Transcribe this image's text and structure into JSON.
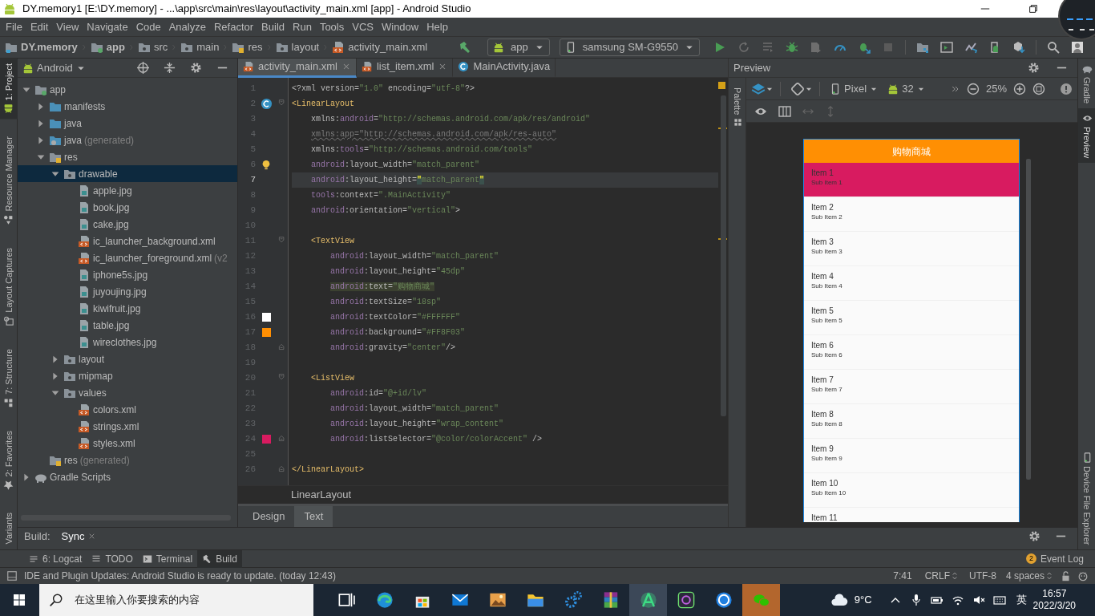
{
  "window": {
    "title": "DY.memory1 [E:\\DY.memory] - ...\\app\\src\\main\\res\\layout\\activity_main.xml [app] - Android Studio"
  },
  "menu": [
    "File",
    "Edit",
    "View",
    "Navigate",
    "Code",
    "Analyze",
    "Refactor",
    "Build",
    "Run",
    "Tools",
    "VCS",
    "Window",
    "Help"
  ],
  "breadcrumb": [
    {
      "label": "DY.memory",
      "kind": "project"
    },
    {
      "label": "app",
      "kind": "module"
    },
    {
      "label": "src",
      "kind": "folder"
    },
    {
      "label": "main",
      "kind": "folder"
    },
    {
      "label": "res",
      "kind": "res-folder"
    },
    {
      "label": "layout",
      "kind": "package"
    },
    {
      "label": "activity_main.xml",
      "kind": "xml"
    }
  ],
  "toolbar": {
    "run_config": "app",
    "device": "samsung SM-G9550"
  },
  "left_strip": [
    {
      "label": "1: Project",
      "kind": "android",
      "selected": true
    },
    {
      "label": "Resource Manager",
      "kind": "shapes",
      "selected": false
    },
    {
      "label": "Layout Captures",
      "kind": "capture",
      "selected": false
    },
    {
      "label": "7: Structure",
      "kind": "structure",
      "selected": false
    },
    {
      "label": "2: Favorites",
      "kind": "star",
      "selected": false
    },
    {
      "label": "Variants",
      "kind": "none",
      "selected": false
    }
  ],
  "project": {
    "view": "Android",
    "tree": [
      {
        "label": "app",
        "kind": "module",
        "expanded": true,
        "selected": false,
        "children": [
          {
            "label": "manifests",
            "kind": "folder",
            "expanded": false,
            "selected": false
          },
          {
            "label": "java",
            "kind": "folder",
            "expanded": false,
            "selected": false
          },
          {
            "label": "java",
            "suffix": "(generated)",
            "kind": "generated-folder",
            "expanded": false,
            "selected": false
          },
          {
            "label": "res",
            "kind": "res-folder",
            "expanded": true,
            "selected": false,
            "children": [
              {
                "label": "drawable",
                "kind": "package",
                "expanded": true,
                "selected": true,
                "children": [
                  {
                    "label": "apple.jpg",
                    "kind": "image",
                    "selected": false
                  },
                  {
                    "label": "book.jpg",
                    "kind": "image",
                    "selected": false
                  },
                  {
                    "label": "cake.jpg",
                    "kind": "image",
                    "selected": false
                  },
                  {
                    "label": "ic_launcher_background.xml",
                    "kind": "xml",
                    "selected": false
                  },
                  {
                    "label": "ic_launcher_foreground.xml",
                    "suffix": "(v2",
                    "kind": "xml",
                    "selected": false
                  },
                  {
                    "label": "iphone5s.jpg",
                    "kind": "image",
                    "selected": false
                  },
                  {
                    "label": "juyoujing.jpg",
                    "kind": "image",
                    "selected": false
                  },
                  {
                    "label": "kiwifruit.jpg",
                    "kind": "image",
                    "selected": false
                  },
                  {
                    "label": "table.jpg",
                    "kind": "image",
                    "selected": false
                  },
                  {
                    "label": "wireclothes.jpg",
                    "kind": "image",
                    "selected": false
                  }
                ]
              },
              {
                "label": "layout",
                "kind": "package",
                "expanded": false,
                "selected": false
              },
              {
                "label": "mipmap",
                "kind": "package",
                "expanded": false,
                "selected": false
              },
              {
                "label": "values",
                "kind": "package",
                "expanded": true,
                "selected": false,
                "children": [
                  {
                    "label": "colors.xml",
                    "kind": "xml",
                    "selected": false
                  },
                  {
                    "label": "strings.xml",
                    "kind": "xml",
                    "selected": false
                  },
                  {
                    "label": "styles.xml",
                    "kind": "xml",
                    "selected": false
                  }
                ]
              }
            ]
          },
          {
            "label": "res",
            "suffix": "(generated)",
            "kind": "res-folder",
            "selected": false
          }
        ]
      },
      {
        "label": "Gradle Scripts",
        "kind": "gradle",
        "expanded": false,
        "selected": false
      }
    ]
  },
  "editor": {
    "tabs": [
      {
        "label": "activity_main.xml",
        "kind": "xml",
        "closable": true,
        "selected": true
      },
      {
        "label": "list_item.xml",
        "kind": "xml",
        "closable": true,
        "selected": false
      },
      {
        "label": "MainActivity.java",
        "kind": "class",
        "closable": false,
        "selected": false
      }
    ],
    "lines": [
      {
        "number": "1",
        "current": false,
        "tokens": [
          {
            "text": "<?xml version=",
            "kind": "attr"
          },
          {
            "text": "\"1.0\"",
            "kind": "value"
          },
          {
            "text": " encoding=",
            "kind": "attr"
          },
          {
            "text": "\"utf-8\"",
            "kind": "value"
          },
          {
            "text": "?>",
            "kind": "attr"
          }
        ]
      },
      {
        "number": "2",
        "current": false,
        "gutter": {
          "kind": "class"
        },
        "fold": {
          "kind": "start"
        },
        "tokens": [
          {
            "text": "<LinearLayout",
            "kind": "tag"
          }
        ]
      },
      {
        "number": "3",
        "current": false,
        "tokens": [
          {
            "text": "    xmlns:",
            "kind": "attr"
          },
          {
            "text": "android",
            "kind": "ns"
          },
          {
            "text": "=",
            "kind": "attr"
          },
          {
            "text": "\"http://schemas.android.com/apk/res/android\"",
            "kind": "value"
          }
        ]
      },
      {
        "number": "4",
        "current": false,
        "tokens": [
          {
            "text": "    xmlns:app=\"http://schemas.android.com/apk/res-auto\"",
            "kind": "warning"
          }
        ]
      },
      {
        "number": "5",
        "current": false,
        "tokens": [
          {
            "text": "    xmlns:",
            "kind": "attr"
          },
          {
            "text": "tools",
            "kind": "ns"
          },
          {
            "text": "=",
            "kind": "attr"
          },
          {
            "text": "\"http://schemas.android.com/tools\"",
            "kind": "value"
          }
        ]
      },
      {
        "number": "6",
        "current": false,
        "gutter": {
          "kind": "bulb"
        },
        "tokens": [
          {
            "text": "    android",
            "kind": "ns"
          },
          {
            "text": ":layout_width=",
            "kind": "attr"
          },
          {
            "text": "\"match_parent\"",
            "kind": "value"
          }
        ]
      },
      {
        "number": "7",
        "current": true,
        "tokens": [
          {
            "text": "    android",
            "kind": "ns"
          },
          {
            "text": ":layout_height=",
            "kind": "attr"
          },
          {
            "text": "\"",
            "kind": "brace"
          },
          {
            "text": "match_parent",
            "kind": "value"
          },
          {
            "text": "\"",
            "kind": "brace"
          }
        ]
      },
      {
        "number": "8",
        "current": false,
        "tokens": [
          {
            "text": "    tools",
            "kind": "ns"
          },
          {
            "text": ":context=",
            "kind": "attr"
          },
          {
            "text": "\".MainActivity\"",
            "kind": "value"
          }
        ]
      },
      {
        "number": "9",
        "current": false,
        "tokens": [
          {
            "text": "    android",
            "kind": "ns"
          },
          {
            "text": ":orientation=",
            "kind": "attr"
          },
          {
            "text": "\"vertical\"",
            "kind": "value"
          },
          {
            "text": ">",
            "kind": "attr"
          }
        ]
      },
      {
        "number": "10",
        "current": false
      },
      {
        "number": "11",
        "current": false,
        "fold": {
          "kind": "start"
        },
        "tokens": [
          {
            "text": "    <TextView",
            "kind": "tag"
          }
        ]
      },
      {
        "number": "12",
        "current": false,
        "tokens": [
          {
            "text": "        android",
            "kind": "ns"
          },
          {
            "text": ":layout_width=",
            "kind": "attr"
          },
          {
            "text": "\"match_parent\"",
            "kind": "value"
          }
        ]
      },
      {
        "number": "13",
        "current": false,
        "tokens": [
          {
            "text": "        android",
            "kind": "ns"
          },
          {
            "text": ":layout_height=",
            "kind": "attr"
          },
          {
            "text": "\"45dp\"",
            "kind": "value"
          }
        ]
      },
      {
        "number": "14",
        "current": false,
        "tokens": [
          {
            "text": "        android",
            "kind": "match-ns"
          },
          {
            "text": ":text=",
            "kind": "match-attr"
          },
          {
            "text": "\"购物商城\"",
            "kind": "match-value"
          }
        ]
      },
      {
        "number": "15",
        "current": false,
        "tokens": [
          {
            "text": "        android",
            "kind": "ns"
          },
          {
            "text": ":textSize=",
            "kind": "attr"
          },
          {
            "text": "\"18sp\"",
            "kind": "value"
          }
        ]
      },
      {
        "number": "16",
        "current": false,
        "gutter": {
          "kind": "color",
          "color": "#ffffff"
        },
        "tokens": [
          {
            "text": "        android",
            "kind": "ns"
          },
          {
            "text": ":textColor=",
            "kind": "attr"
          },
          {
            "text": "\"#FFFFFF\"",
            "kind": "value"
          }
        ]
      },
      {
        "number": "17",
        "current": false,
        "gutter": {
          "kind": "color",
          "color": "#ff8f03"
        },
        "tokens": [
          {
            "text": "        android",
            "kind": "ns"
          },
          {
            "text": ":background=",
            "kind": "attr"
          },
          {
            "text": "\"#FF8F03\"",
            "kind": "value"
          }
        ]
      },
      {
        "number": "18",
        "current": false,
        "fold": {
          "kind": "end"
        },
        "tokens": [
          {
            "text": "        android",
            "kind": "ns"
          },
          {
            "text": ":gravity=",
            "kind": "attr"
          },
          {
            "text": "\"center\"",
            "kind": "value"
          },
          {
            "text": "/>",
            "kind": "attr"
          }
        ]
      },
      {
        "number": "19",
        "current": false
      },
      {
        "number": "20",
        "current": false,
        "fold": {
          "kind": "start"
        },
        "tokens": [
          {
            "text": "    <ListView",
            "kind": "tag"
          }
        ]
      },
      {
        "number": "21",
        "current": false,
        "tokens": [
          {
            "text": "        android",
            "kind": "ns"
          },
          {
            "text": ":id=",
            "kind": "attr"
          },
          {
            "text": "\"@+id/lv\"",
            "kind": "value"
          }
        ]
      },
      {
        "number": "22",
        "current": false,
        "tokens": [
          {
            "text": "        android",
            "kind": "ns"
          },
          {
            "text": ":layout_width=",
            "kind": "attr"
          },
          {
            "text": "\"match_parent\"",
            "kind": "value"
          }
        ]
      },
      {
        "number": "23",
        "current": false,
        "tokens": [
          {
            "text": "        android",
            "kind": "ns"
          },
          {
            "text": ":layout_height=",
            "kind": "attr"
          },
          {
            "text": "\"wrap_content\"",
            "kind": "value"
          }
        ]
      },
      {
        "number": "24",
        "current": false,
        "gutter": {
          "kind": "color",
          "color": "#d81b60"
        },
        "fold": {
          "kind": "end"
        },
        "tokens": [
          {
            "text": "        android",
            "kind": "ns"
          },
          {
            "text": ":listSelector=",
            "kind": "attr"
          },
          {
            "text": "\"@color/colorAccent\"",
            "kind": "value"
          },
          {
            "text": " />",
            "kind": "attr"
          }
        ]
      },
      {
        "number": "25",
        "current": false
      },
      {
        "number": "26",
        "current": false,
        "fold": {
          "kind": "end"
        },
        "tokens": [
          {
            "text": "</LinearLayout>",
            "kind": "tag"
          }
        ]
      }
    ],
    "breadcrumb": "LinearLayout",
    "mode_tabs": [
      {
        "label": "Design",
        "selected": false
      },
      {
        "label": "Text",
        "selected": true
      }
    ]
  },
  "preview": {
    "title": "Preview",
    "palette": "Palette",
    "device": "Pixel",
    "api": "32",
    "zoom": "25%",
    "phone": {
      "title": "购物商城",
      "items": [
        {
          "title": "Item 1",
          "subtitle": "Sub Item 1",
          "selected": true
        },
        {
          "title": "Item 2",
          "subtitle": "Sub Item 2",
          "selected": false
        },
        {
          "title": "Item 3",
          "subtitle": "Sub Item 3",
          "selected": false
        },
        {
          "title": "Item 4",
          "subtitle": "Sub Item 4",
          "selected": false
        },
        {
          "title": "Item 5",
          "subtitle": "Sub Item 5",
          "selected": false
        },
        {
          "title": "Item 6",
          "subtitle": "Sub Item 6",
          "selected": false
        },
        {
          "title": "Item 7",
          "subtitle": "Sub Item 7",
          "selected": false
        },
        {
          "title": "Item 8",
          "subtitle": "Sub Item 8",
          "selected": false
        },
        {
          "title": "Item 9",
          "subtitle": "Sub Item 9",
          "selected": false
        },
        {
          "title": "Item 10",
          "subtitle": "Sub Item 10",
          "selected": false
        },
        {
          "title": "Item 11",
          "selected": false
        }
      ]
    }
  },
  "right_strip": [
    {
      "label": "Gradle",
      "kind": "gradle",
      "selected": false
    },
    {
      "label": "Preview",
      "kind": "eye",
      "selected": true
    },
    {
      "label": "Device File Explorer",
      "kind": "phone",
      "selected": false
    }
  ],
  "build_bar": {
    "label": "Build:",
    "tabs": [
      {
        "label": "Sync",
        "selected": true
      }
    ]
  },
  "tool_tabs": [
    {
      "label": "6: Logcat",
      "kind": "logcat",
      "selected": false
    },
    {
      "label": "TODO",
      "kind": "todo",
      "selected": false
    },
    {
      "label": "Terminal",
      "kind": "terminal",
      "selected": false
    },
    {
      "label": "Build",
      "kind": "build",
      "selected": true
    }
  ],
  "event_log": {
    "label": "Event Log",
    "count": "2"
  },
  "status_bar": {
    "message": "IDE and Plugin Updates: Android Studio is ready to update. (today 12:43)",
    "position": "7:41",
    "line_separator": "CRLF",
    "encoding": "UTF-8",
    "indent": "4 spaces"
  },
  "taskbar": {
    "search_placeholder": "在这里输入你要搜索的内容",
    "apps": [
      {
        "kind": "task-view",
        "active": false,
        "flashing": false
      },
      {
        "kind": "browser",
        "active": false,
        "flashing": false
      },
      {
        "kind": "store",
        "active": false,
        "flashing": false
      },
      {
        "kind": "mail",
        "active": false,
        "flashing": false
      },
      {
        "kind": "photos",
        "active": false,
        "flashing": false
      },
      {
        "kind": "folder",
        "active": false,
        "flashing": false
      },
      {
        "kind": "gears",
        "active": false,
        "flashing": false
      },
      {
        "kind": "archive",
        "active": false,
        "flashing": false
      },
      {
        "kind": "studio",
        "active": true,
        "flashing": false
      },
      {
        "kind": "emulator",
        "active": false,
        "flashing": false
      },
      {
        "kind": "circle-app",
        "active": false,
        "flashing": false
      },
      {
        "kind": "chat",
        "active": false,
        "flashing": true
      }
    ],
    "weather": "9°C",
    "input_method": "英",
    "time": "16:57",
    "date": "2022/3/20"
  }
}
